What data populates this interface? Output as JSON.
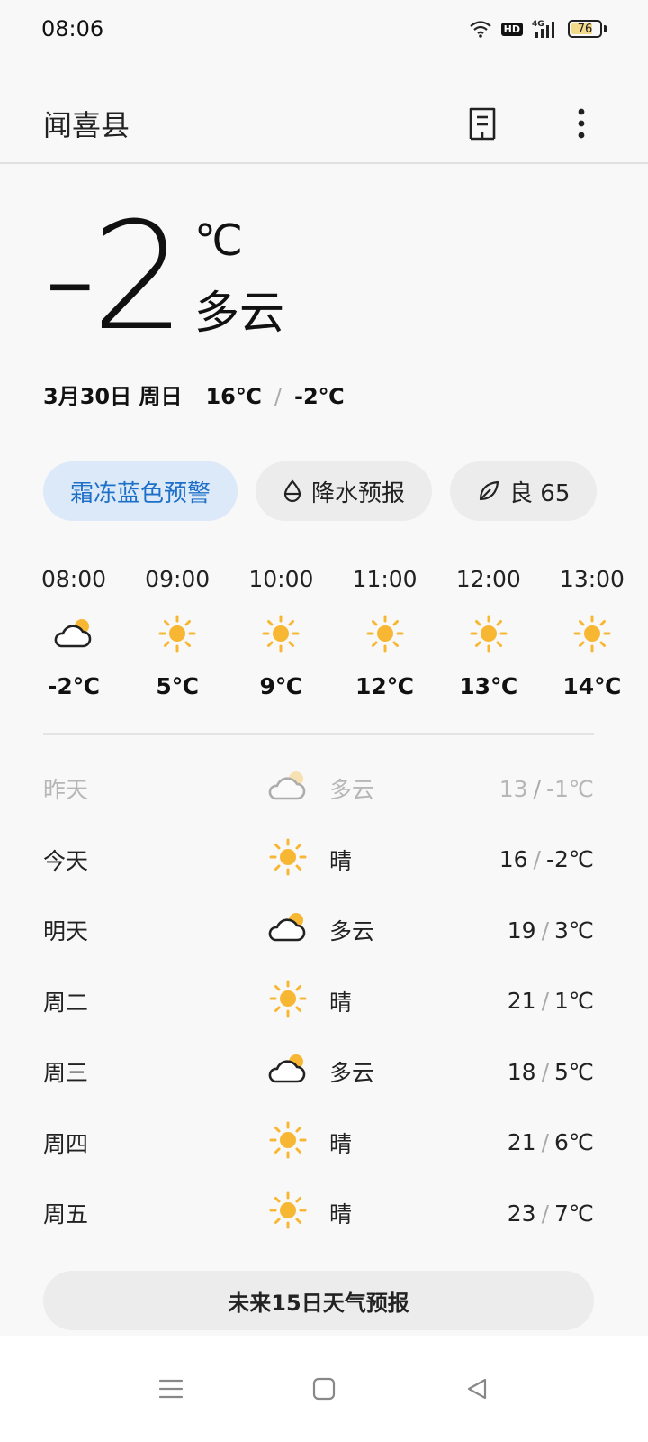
{
  "status_bar": {
    "time": "08:06",
    "battery": "76",
    "battery_level": 0.76,
    "hd": "HD",
    "network": "4G"
  },
  "header": {
    "city": "闻喜县"
  },
  "current": {
    "temp": "-2",
    "unit": "℃",
    "condition": "多云"
  },
  "date_line": {
    "date": "3月30日 周日",
    "high": "16℃",
    "sep": "/",
    "low": "-2℃"
  },
  "chips": {
    "alert": "霜冻蓝色预警",
    "precip": "降水预报",
    "aqi": "良 65"
  },
  "hourly": [
    {
      "time": "08:00",
      "icon": "partly-cloudy",
      "temp": "-2℃"
    },
    {
      "time": "09:00",
      "icon": "sunny",
      "temp": "5℃"
    },
    {
      "time": "10:00",
      "icon": "sunny",
      "temp": "9℃"
    },
    {
      "time": "11:00",
      "icon": "sunny",
      "temp": "12℃"
    },
    {
      "time": "12:00",
      "icon": "sunny",
      "temp": "13℃"
    },
    {
      "time": "13:00",
      "icon": "sunny",
      "temp": "14℃"
    }
  ],
  "daily": [
    {
      "day": "昨天",
      "icon": "partly-cloudy",
      "cond": "多云",
      "high": "13",
      "low": "-1℃",
      "sep": "/"
    },
    {
      "day": "今天",
      "icon": "sunny",
      "cond": "晴",
      "high": "16",
      "low": "-2℃",
      "sep": "/"
    },
    {
      "day": "明天",
      "icon": "partly-cloudy",
      "cond": "多云",
      "high": "19",
      "low": "3℃",
      "sep": "/"
    },
    {
      "day": "周二",
      "icon": "sunny",
      "cond": "晴",
      "high": "21",
      "low": "1℃",
      "sep": "/"
    },
    {
      "day": "周三",
      "icon": "partly-cloudy",
      "cond": "多云",
      "high": "18",
      "low": "5℃",
      "sep": "/"
    },
    {
      "day": "周四",
      "icon": "sunny",
      "cond": "晴",
      "high": "21",
      "low": "6℃",
      "sep": "/"
    },
    {
      "day": "周五",
      "icon": "sunny",
      "cond": "晴",
      "high": "23",
      "low": "7℃",
      "sep": "/"
    }
  ],
  "forecast_button": "未来15日天气预报",
  "colors": {
    "sun": "#f7b733",
    "alert_bg": "#dbe9f8",
    "alert_text": "#1e6fc8"
  }
}
